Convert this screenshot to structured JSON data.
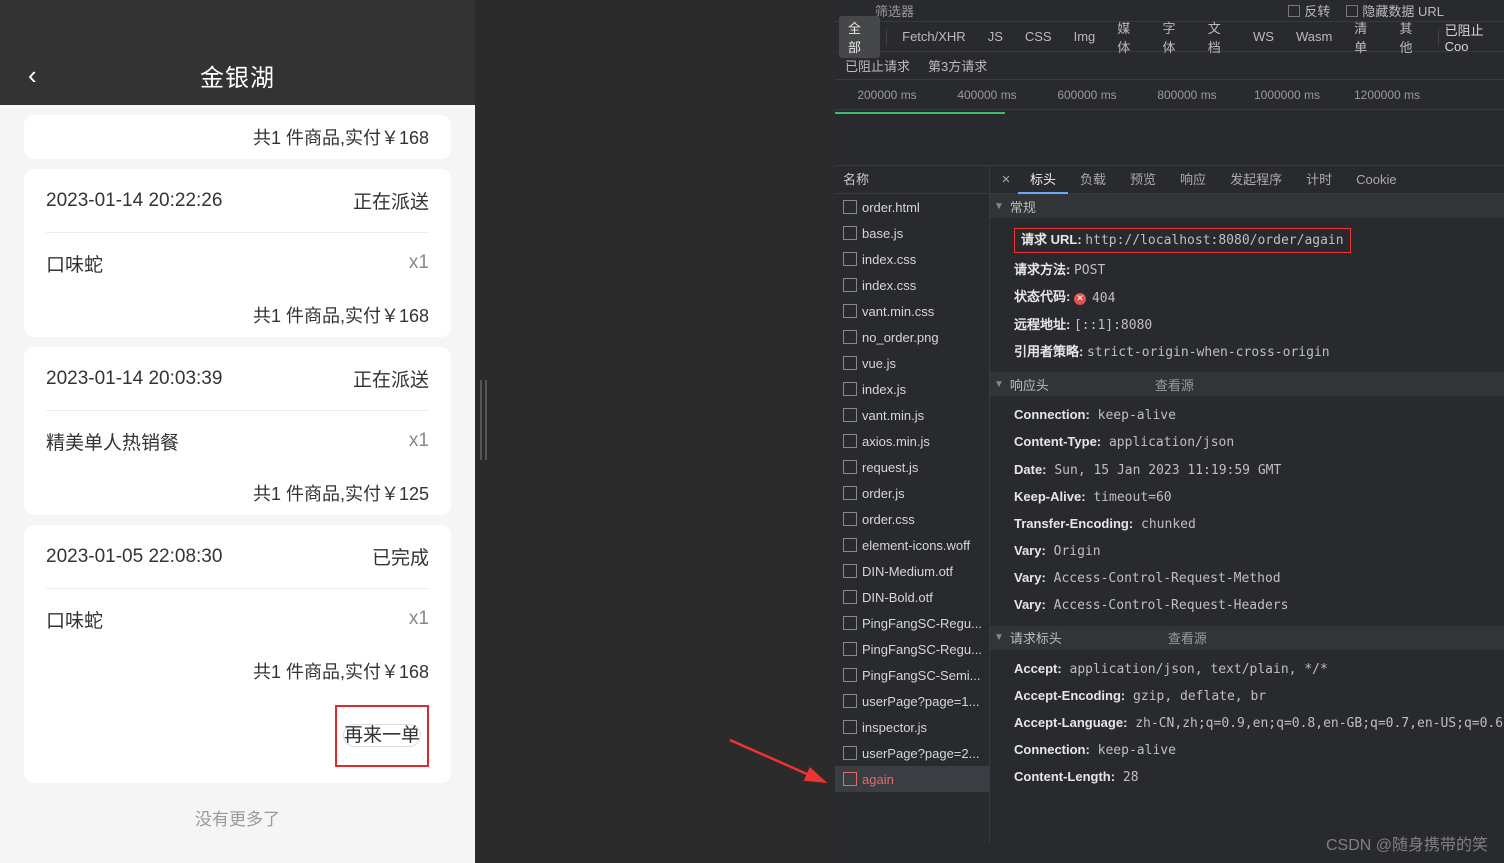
{
  "mobile": {
    "title": "金银湖",
    "orders": [
      {
        "summary": "共1 件商品,实付￥168"
      },
      {
        "time": "2023-01-14 20:22:26",
        "status": "正在派送",
        "item_name": "口味蛇",
        "item_qty": "x1",
        "summary": "共1 件商品,实付￥168"
      },
      {
        "time": "2023-01-14 20:03:39",
        "status": "正在派送",
        "item_name": "精美单人热销餐",
        "item_qty": "x1",
        "summary": "共1 件商品,实付￥125"
      },
      {
        "time": "2023-01-05 22:08:30",
        "status": "已完成",
        "item_name": "口味蛇",
        "item_qty": "x1",
        "summary": "共1 件商品,实付￥168",
        "action": "再来一单"
      }
    ],
    "nomore": "没有更多了"
  },
  "devtools": {
    "top": {
      "filter_label": "筛选器",
      "invert": "反转",
      "hide_url": "隐藏数据 URL",
      "blocked_req": "已阻止请求",
      "third": "第3方请求",
      "blocked_cookies": "已阻止 Coo"
    },
    "filters": [
      "全部",
      "Fetch/XHR",
      "JS",
      "CSS",
      "Img",
      "媒体",
      "字体",
      "文档",
      "WS",
      "Wasm",
      "清单",
      "其他"
    ],
    "timeline": [
      "200000 ms",
      "400000 ms",
      "600000 ms",
      "800000 ms",
      "1000000 ms",
      "1200000 ms"
    ],
    "name_col": {
      "header": "名称",
      "files": [
        "order.html",
        "base.js",
        "index.css",
        "index.css",
        "vant.min.css",
        "no_order.png",
        "vue.js",
        "index.js",
        "vant.min.js",
        "axios.min.js",
        "request.js",
        "order.js",
        "order.css",
        "element-icons.woff",
        "DIN-Medium.otf",
        "DIN-Bold.otf",
        "PingFangSC-Regu...",
        "PingFangSC-Regu...",
        "PingFangSC-Semi...",
        "userPage?page=1...",
        "inspector.js",
        "userPage?page=2...",
        "again"
      ]
    },
    "det_tabs": {
      "close": "×",
      "headers": "标头",
      "payload": "负载",
      "preview": "预览",
      "resp": "响应",
      "init": "发起程序",
      "timing": "计时",
      "cookie": "Cookie"
    },
    "general": {
      "title": "常规",
      "url_k": "请求 URL:",
      "url_v": "http://localhost:8080/order/again",
      "method_k": "请求方法:",
      "method_v": "POST",
      "status_k": "状态代码:",
      "status_v": "404",
      "remote_k": "远程地址:",
      "remote_v": "[::1]:8080",
      "ref_k": "引用者策略:",
      "ref_v": "strict-origin-when-cross-origin"
    },
    "resp_hdr": {
      "title": "响应头",
      "more": "查看源",
      "rows": [
        {
          "k": "Connection:",
          "v": "keep-alive"
        },
        {
          "k": "Content-Type:",
          "v": "application/json"
        },
        {
          "k": "Date:",
          "v": "Sun, 15 Jan 2023 11:19:59 GMT"
        },
        {
          "k": "Keep-Alive:",
          "v": "timeout=60"
        },
        {
          "k": "Transfer-Encoding:",
          "v": "chunked"
        },
        {
          "k": "Vary:",
          "v": "Origin"
        },
        {
          "k": "Vary:",
          "v": "Access-Control-Request-Method"
        },
        {
          "k": "Vary:",
          "v": "Access-Control-Request-Headers"
        }
      ]
    },
    "req_hdr": {
      "title": "请求标头",
      "more": "查看源",
      "rows": [
        {
          "k": "Accept:",
          "v": "application/json, text/plain, */*"
        },
        {
          "k": "Accept-Encoding:",
          "v": "gzip, deflate, br"
        },
        {
          "k": "Accept-Language:",
          "v": "zh-CN,zh;q=0.9,en;q=0.8,en-GB;q=0.7,en-US;q=0.6"
        },
        {
          "k": "Connection:",
          "v": "keep-alive"
        },
        {
          "k": "Content-Length:",
          "v": "28"
        }
      ]
    }
  },
  "watermark": "CSDN @随身携带的笑"
}
